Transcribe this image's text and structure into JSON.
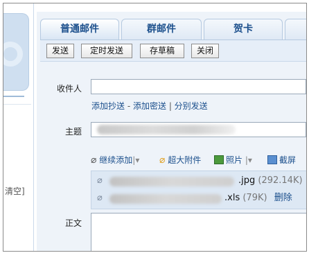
{
  "tabs": [
    {
      "label": "普通邮件"
    },
    {
      "label": "群邮件"
    },
    {
      "label": "贺卡"
    },
    {
      "label": ""
    }
  ],
  "toolbar": {
    "send": "发送",
    "schedule": "定时发送",
    "draft": "存草稿",
    "close": "关闭"
  },
  "sidebar": {
    "clear_text": "清空]"
  },
  "form": {
    "to_label": "收件人",
    "cc_link": "添加抄送",
    "dash": " - ",
    "bcc_link": "添加密送",
    "pipe": " | ",
    "separate_link": "分别发送",
    "subject_label": "主题",
    "body_label": "正文"
  },
  "attach_bar": {
    "continue_add": "继续添加",
    "large_attachment": "超大附件",
    "photo": "照片",
    "screenshot": "截屏"
  },
  "attachments": [
    {
      "ext": ".jpg",
      "size": "(292.14K)",
      "delete": ""
    },
    {
      "ext": ".xls",
      "size": "(79K)",
      "delete": "删除"
    }
  ]
}
